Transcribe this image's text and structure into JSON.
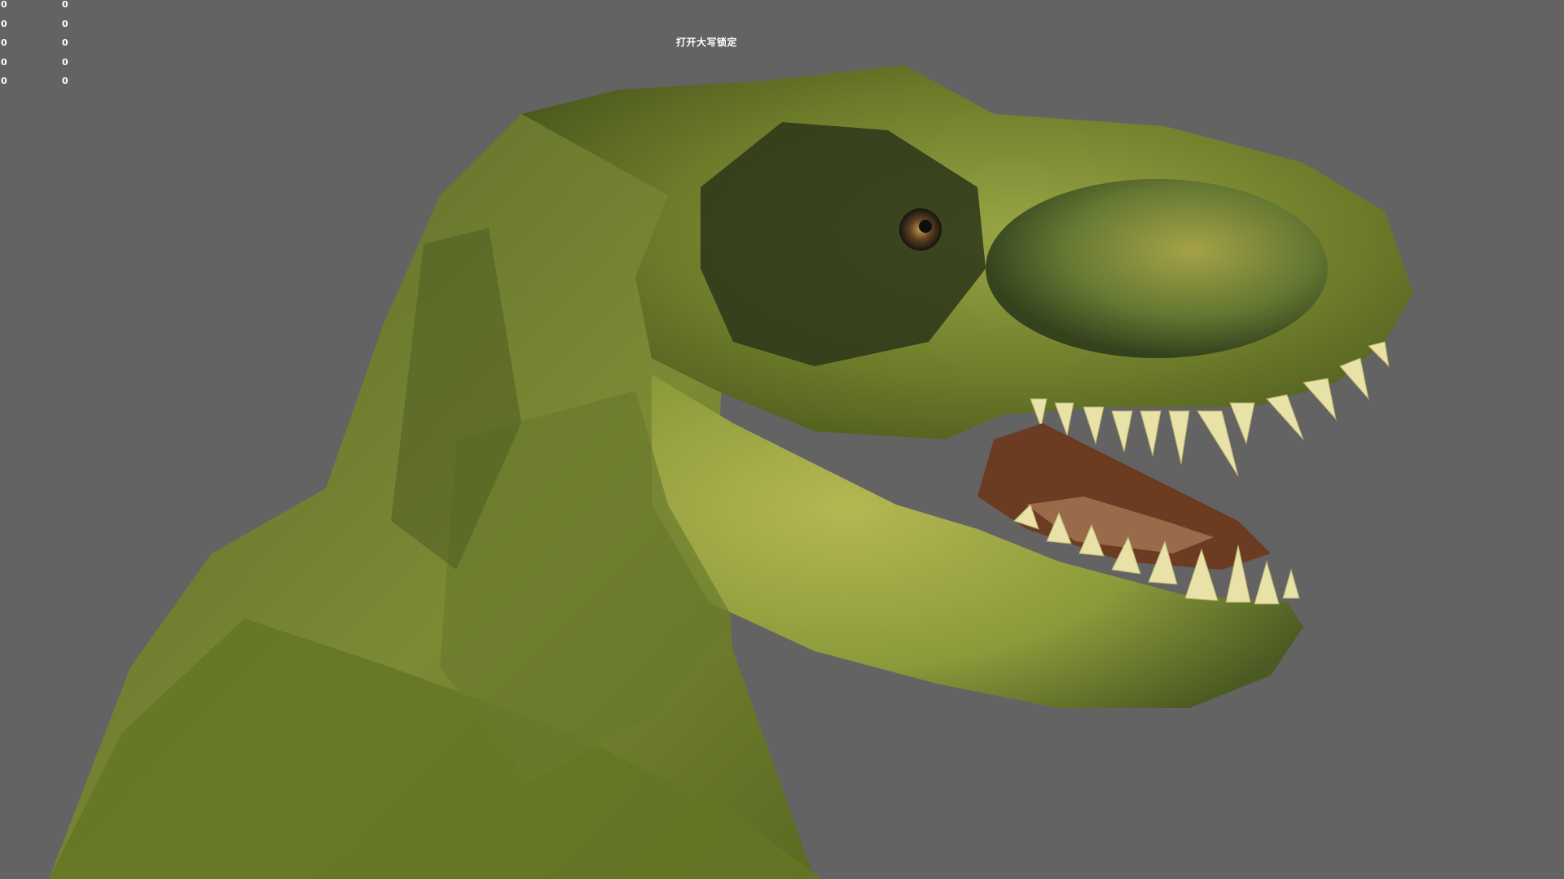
{
  "viewport": {
    "background_color": "#636363",
    "caps_lock_indicator": "打开大写锁定"
  },
  "stats": {
    "rows": [
      {
        "a": "0",
        "b": "0"
      },
      {
        "a": "0",
        "b": "0"
      },
      {
        "a": "0",
        "b": "0"
      },
      {
        "a": "0",
        "b": "0"
      },
      {
        "a": "0",
        "b": "0"
      }
    ]
  },
  "model": {
    "subject": "tyrannosaurus-rex-head",
    "skin_color": "#6b7a2a",
    "teeth_color": "#e8e2a8"
  }
}
